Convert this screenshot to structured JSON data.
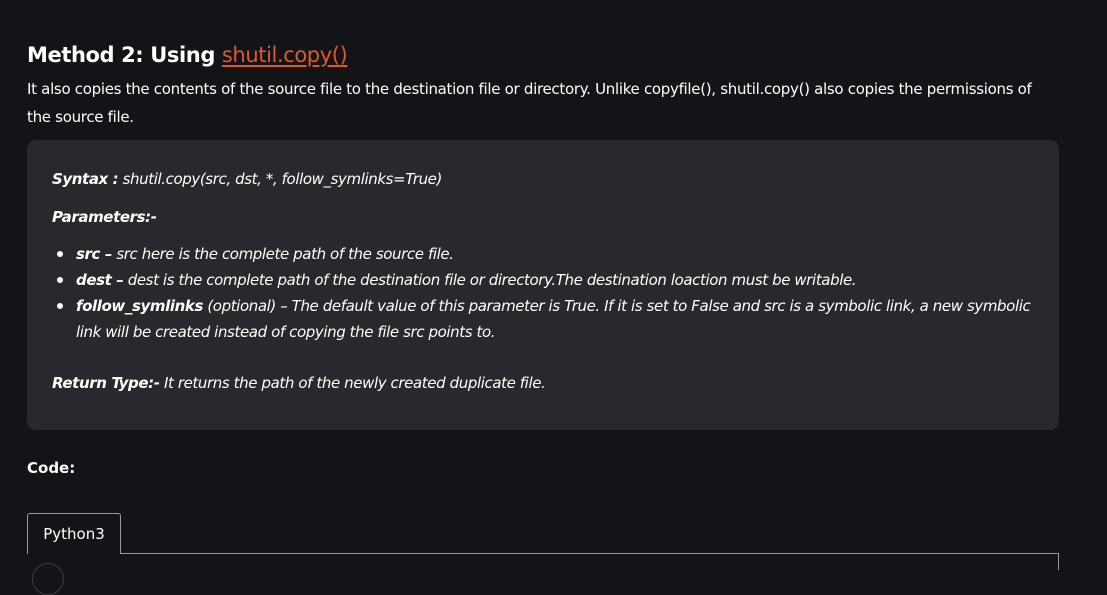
{
  "heading": {
    "prefix": "Method 2: Using ",
    "link_text": "shutil.copy()"
  },
  "intro": "It also copies the contents of the source file to the destination file or directory. Unlike copyfile(), shutil.copy() also copies the permissions of the source file.",
  "syntax_box": {
    "syntax_label": "Syntax :",
    "syntax_text": " shutil.copy(src, dst, *, follow_symlinks=True)",
    "parameters_label": "Parameters:-",
    "params": [
      {
        "name": "src –",
        "desc": " src here is the complete path of the source file."
      },
      {
        "name": "dest –",
        "desc": " dest is the complete path of the destination file or directory.The destination loaction must be writable."
      },
      {
        "name": "follow_symlinks",
        "desc": " (optional) – The default value of this parameter is True. If it is set to False and src is a symbolic link, a new symbolic link will be created instead of copying the file src points to."
      }
    ],
    "return_label": "Return Type:-",
    "return_text": " It returns the path of the newly created duplicate file."
  },
  "code_label": "Code:",
  "tabs": [
    {
      "label": "Python3"
    }
  ],
  "colors": {
    "background": "#131417",
    "box": "#28292c",
    "link": "#e2552d"
  }
}
